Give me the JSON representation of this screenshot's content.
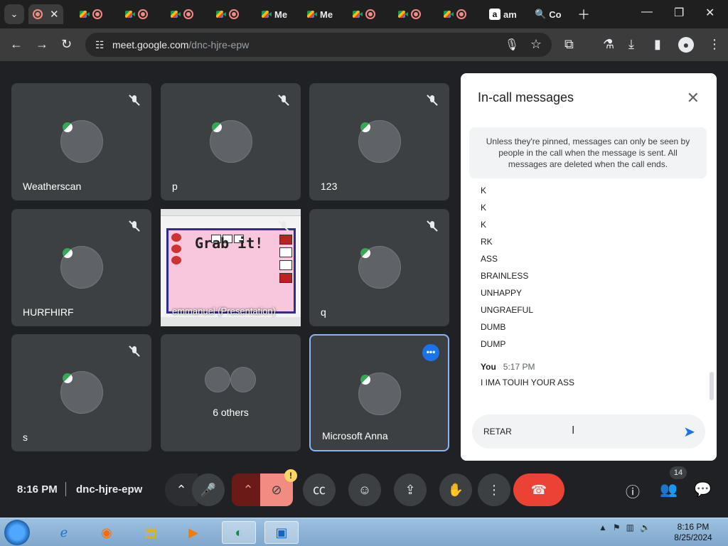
{
  "browser": {
    "tabs": [
      {
        "label": "",
        "icon": "record-icon",
        "active": true
      },
      {
        "label": "",
        "icon": "google-meet-icon"
      },
      {
        "label": "",
        "icon": "google-meet-icon"
      },
      {
        "label": "",
        "icon": "google-meet-icon"
      },
      {
        "label": "Me",
        "icon": "google-meet-icon"
      },
      {
        "label": "Me",
        "icon": "google-meet-icon"
      },
      {
        "label": "",
        "icon": "google-meet-icon"
      },
      {
        "label": "",
        "icon": "google-meet-icon"
      },
      {
        "label": "",
        "icon": "google-meet-icon"
      },
      {
        "label": "am",
        "icon": "amazon-icon"
      },
      {
        "label": "Co",
        "icon": "search-icon"
      }
    ],
    "url_domain": "meet.google.com",
    "url_path": "/dnc-hjre-epw"
  },
  "participants": [
    {
      "name": "Weatherscan"
    },
    {
      "name": "p"
    },
    {
      "name": "123"
    },
    {
      "name": "HURFHIRF"
    },
    {
      "name": "q"
    },
    {
      "name": "s"
    },
    {
      "name": "Microsoft Anna"
    }
  ],
  "presentation": {
    "title": "Grab it!",
    "caption": "emmanuel (Presentation)"
  },
  "others": {
    "label": "6 others"
  },
  "chat": {
    "title": "In-call messages",
    "notice": "Unless they're pinned, messages can only be seen by people in the call when the message is sent. All messages are deleted when the call ends.",
    "messages": [
      "K",
      "K",
      "K",
      "RK",
      "ASS",
      "BRAINLESS",
      "UNHAPPY",
      "UNGRAEFUL",
      "DUMB",
      "DUMP"
    ],
    "own": {
      "sender": "You",
      "time": "5:17 PM",
      "text": "I IMA TOUIH YOUR ASS"
    },
    "input_value": "RETAR"
  },
  "controls": {
    "time": "8:16 PM",
    "meeting_code": "dnc-hjre-epw",
    "participant_count": "14",
    "warning_symbol": "!"
  },
  "taskbar": {
    "clock_time": "8:16 PM",
    "clock_date": "8/25/2024"
  },
  "colors": {
    "meet_bg": "#202124",
    "tile_bg": "#3c4043",
    "accent_blue": "#1a73e8",
    "end_call_red": "#ea4335"
  }
}
